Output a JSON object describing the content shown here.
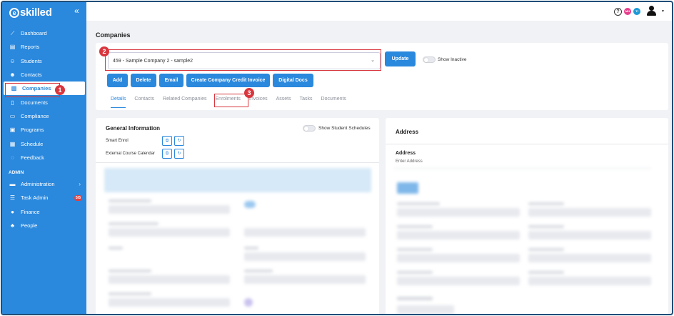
{
  "app": {
    "logo": "skilled",
    "logo_mark": "e",
    "collapse_icon": "double-chevron-left-icon"
  },
  "sidebar": {
    "items": [
      {
        "label": "Dashboard",
        "icon": "chart-line-icon"
      },
      {
        "label": "Reports",
        "icon": "report-icon"
      },
      {
        "label": "Students",
        "icon": "students-icon"
      },
      {
        "label": "Contacts",
        "icon": "contacts-icon"
      },
      {
        "label": "Companies",
        "icon": "companies-icon",
        "active": true
      },
      {
        "label": "Documents",
        "icon": "document-icon"
      },
      {
        "label": "Compliance",
        "icon": "compliance-icon"
      },
      {
        "label": "Programs",
        "icon": "programs-icon"
      },
      {
        "label": "Schedule",
        "icon": "calendar-icon"
      },
      {
        "label": "Feedback",
        "icon": "feedback-icon"
      }
    ],
    "admin_label": "ADMIN",
    "admin_items": [
      {
        "label": "Administration",
        "icon": "admin-icon"
      },
      {
        "label": "Task Admin",
        "icon": "tasks-icon",
        "badge": "5/5"
      },
      {
        "label": "Finance",
        "icon": "finance-icon"
      },
      {
        "label": "People",
        "icon": "people-icon"
      }
    ]
  },
  "topbar": {
    "help": "?",
    "avatar1": {
      "text": "MH",
      "color": "#e83e8c"
    },
    "avatar2": {
      "text": "TI",
      "color": "#1f9ad6"
    }
  },
  "page": {
    "title": "Companies"
  },
  "company_select": {
    "value": "459 - Sample Company 2 - sample2"
  },
  "buttons": {
    "update": "Update",
    "add": "Add",
    "delete": "Delete",
    "email": "Email",
    "credit_invoice": "Create Company Credit Invoice",
    "digital_docs": "Digital Docs"
  },
  "show_inactive": "Show Inactive",
  "tabs": [
    "Details",
    "Contacts",
    "Related Companies",
    "Enrolments",
    "Invoices",
    "Assets",
    "Tasks",
    "Documents"
  ],
  "annotations": [
    "1",
    "2",
    "3"
  ],
  "general": {
    "title": "General Information",
    "show_schedules": "Show Student Schedules",
    "smart_enrol": "Smart Enrol",
    "external_calendar": "External Course Calendar"
  },
  "address": {
    "title": "Address",
    "sub_title": "Address",
    "enter": "Enter Address"
  },
  "colors": {
    "accent": "#2a88dd",
    "annotation": "#d9363e"
  }
}
